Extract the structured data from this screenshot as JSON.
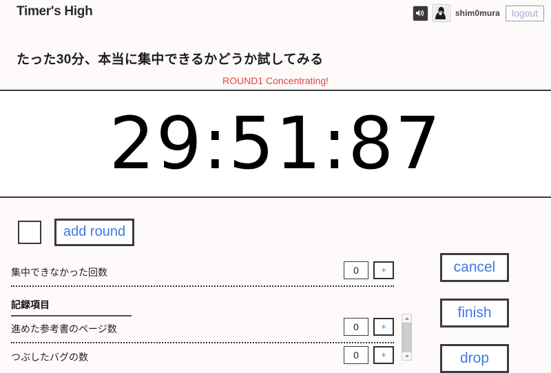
{
  "header": {
    "app_title": "Timer's High",
    "sound_icon": "speaker-icon",
    "avatar_alt": "avatar",
    "user_name": "shim0mura",
    "logout_label": "logout"
  },
  "task": {
    "title": "たった30分、本当に集中できるかどうか試してみる",
    "round_status": "ROUND1 Concentrating!",
    "round_status_color": "#e2453f"
  },
  "timer": {
    "value": "29:51:87"
  },
  "round_adder": {
    "input_value": "",
    "add_round_label": "add round"
  },
  "miss_counter": {
    "label": "集中できなかった回数",
    "value": "0",
    "plus_label": "+"
  },
  "records": {
    "section_title": "記録項目",
    "items": [
      {
        "label": "進めた参考書のページ数",
        "value": "0",
        "plus_label": "+"
      },
      {
        "label": "つぶしたバグの数",
        "value": "0",
        "plus_label": "+"
      }
    ]
  },
  "actions": {
    "cancel_label": "cancel",
    "finish_label": "finish",
    "drop_label": "drop"
  },
  "colors": {
    "link_blue": "#3c7ae4",
    "status_red": "#e2453f",
    "border_dark": "#3b3b3b",
    "page_bg": "#fdfaf9"
  }
}
